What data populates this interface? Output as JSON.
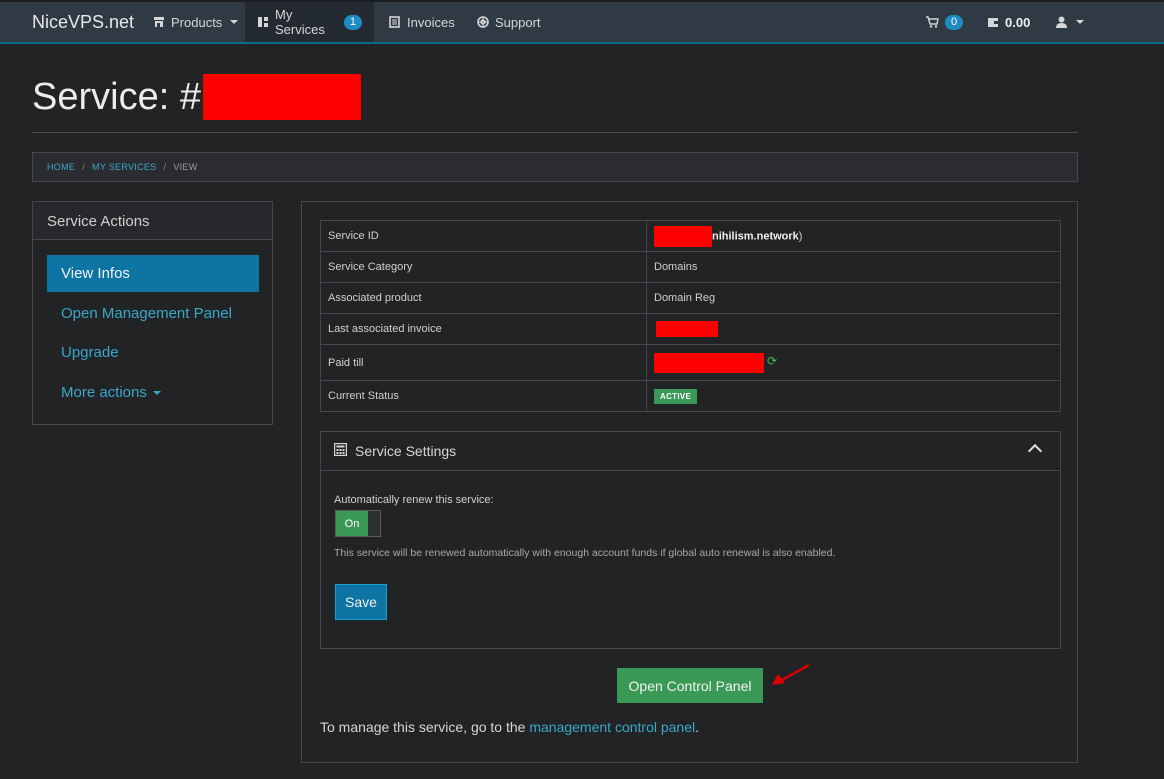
{
  "navbar": {
    "brand": "NiceVPS.net",
    "items": [
      {
        "label": "Products",
        "icon": "store-icon"
      },
      {
        "label": "My Services",
        "icon": "services-icon",
        "badge": "1"
      },
      {
        "label": "Invoices",
        "icon": "invoice-icon"
      },
      {
        "label": "Support",
        "icon": "lifebuoy-icon"
      }
    ],
    "cart_count": "0",
    "balance": "0.00"
  },
  "page": {
    "title_prefix": "Service: #"
  },
  "breadcrumb": {
    "home": "HOME",
    "services": "MY SERVICES",
    "current": "VIEW"
  },
  "sidebar": {
    "heading": "Service Actions",
    "items": [
      {
        "label": "View Infos"
      },
      {
        "label": "Open Management Panel"
      },
      {
        "label": "Upgrade"
      },
      {
        "label": "More actions"
      }
    ]
  },
  "info": {
    "rows": [
      {
        "key": "Service ID",
        "value": "nihilism.network",
        "value_suffix": ")"
      },
      {
        "key": "Service Category",
        "value": "Domains"
      },
      {
        "key": "Associated product",
        "value": "Domain Reg"
      },
      {
        "key": "Last associated invoice",
        "value": ""
      },
      {
        "key": "Paid till",
        "value": ""
      },
      {
        "key": "Current Status",
        "value": "ACTIVE"
      }
    ]
  },
  "settings": {
    "heading": "Service Settings",
    "auto_renew_label": "Automatically renew this service:",
    "toggle_state": "On",
    "help_text": "This service will be renewed automatically with enough account funds if global auto renewal is also enabled.",
    "save_label": "Save"
  },
  "actions": {
    "open_control_panel": "Open Control Panel",
    "manage_prefix": "To manage this service, go to the ",
    "manage_link": "management control panel",
    "manage_suffix": "."
  },
  "colors": {
    "accent": "#0d74a3",
    "success": "#3a9a55",
    "link": "#3aa7c9",
    "redaction": "#ff0000"
  }
}
